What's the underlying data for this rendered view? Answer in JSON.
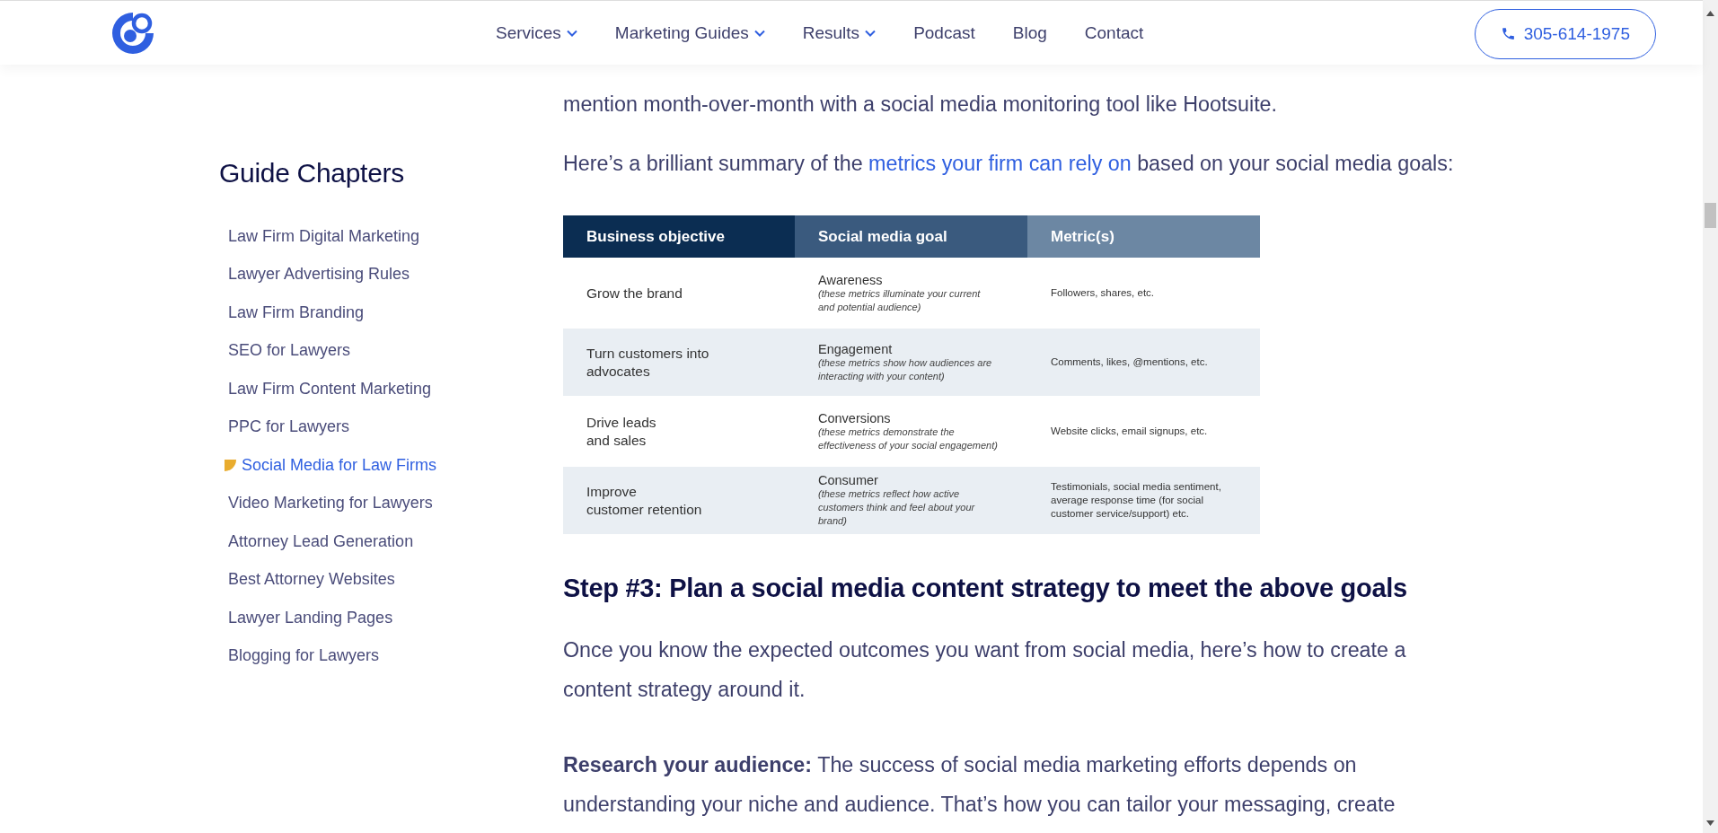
{
  "header": {
    "nav": [
      {
        "label": "Services",
        "dropdown": true
      },
      {
        "label": "Marketing Guides",
        "dropdown": true
      },
      {
        "label": "Results",
        "dropdown": true
      },
      {
        "label": "Podcast",
        "dropdown": false
      },
      {
        "label": "Blog",
        "dropdown": false
      },
      {
        "label": "Contact",
        "dropdown": false
      }
    ],
    "phone": "305-614-1975"
  },
  "sidebar": {
    "title": "Guide Chapters",
    "items": [
      {
        "label": "Law Firm Digital Marketing",
        "selected": false
      },
      {
        "label": "Lawyer Advertising Rules",
        "selected": false
      },
      {
        "label": "Law Firm Branding",
        "selected": false
      },
      {
        "label": "SEO for Lawyers",
        "selected": false
      },
      {
        "label": "Law Firm Content Marketing",
        "selected": false
      },
      {
        "label": "PPC for Lawyers",
        "selected": false
      },
      {
        "label": "Social Media for Law Firms",
        "selected": true
      },
      {
        "label": "Video Marketing for Lawyers",
        "selected": false
      },
      {
        "label": "Attorney Lead Generation",
        "selected": false
      },
      {
        "label": "Best Attorney Websites",
        "selected": false
      },
      {
        "label": "Lawyer Landing Pages",
        "selected": false
      },
      {
        "label": "Blogging for Lawyers",
        "selected": false
      }
    ]
  },
  "article": {
    "intro": "mention month-over-month with a social media monitoring tool like Hootsuite.",
    "summary": {
      "before": "Here’s a brilliant summary of the ",
      "link": "metrics your firm can rely on",
      "after": " based on your social media goals:"
    },
    "table": {
      "columns": [
        "Business objective",
        "Social media goal",
        "Metric(s)"
      ],
      "rows": [
        {
          "objective": "Grow the brand",
          "goal": "Awareness",
          "goal_note": "(these metrics illuminate your current\nand potential audience)",
          "metric": "Followers, shares, etc."
        },
        {
          "objective": "Turn customers into\nadvocates",
          "goal": "Engagement",
          "goal_note": "(these metrics show how audiences are\ninteracting with your content)",
          "metric": "Comments, likes, @mentions, etc."
        },
        {
          "objective": "Drive leads\nand sales",
          "goal": "Conversions",
          "goal_note": "(these metrics demonstrate the\neffectiveness of your social engagement)",
          "metric": "Website clicks, email signups, etc."
        },
        {
          "objective": "Improve\ncustomer retention",
          "goal": "Consumer",
          "goal_note": "(these metrics reflect how active\ncustomers think and feel about your\nbrand)",
          "metric": "Testimonials, social media sentiment,\naverage response time (for social\ncustomer service/support) etc."
        }
      ]
    },
    "step_heading": "Step #3: Plan a social media content strategy to meet the above goals",
    "paragraphs": [
      "Once you know the expected outcomes you want from social media, here’s how to create a content strategy around it.",
      "**Research your audience:** The success of social media marketing efforts depends on understanding your niche and audience. That’s how you can tailor your messaging, create"
    ]
  }
}
